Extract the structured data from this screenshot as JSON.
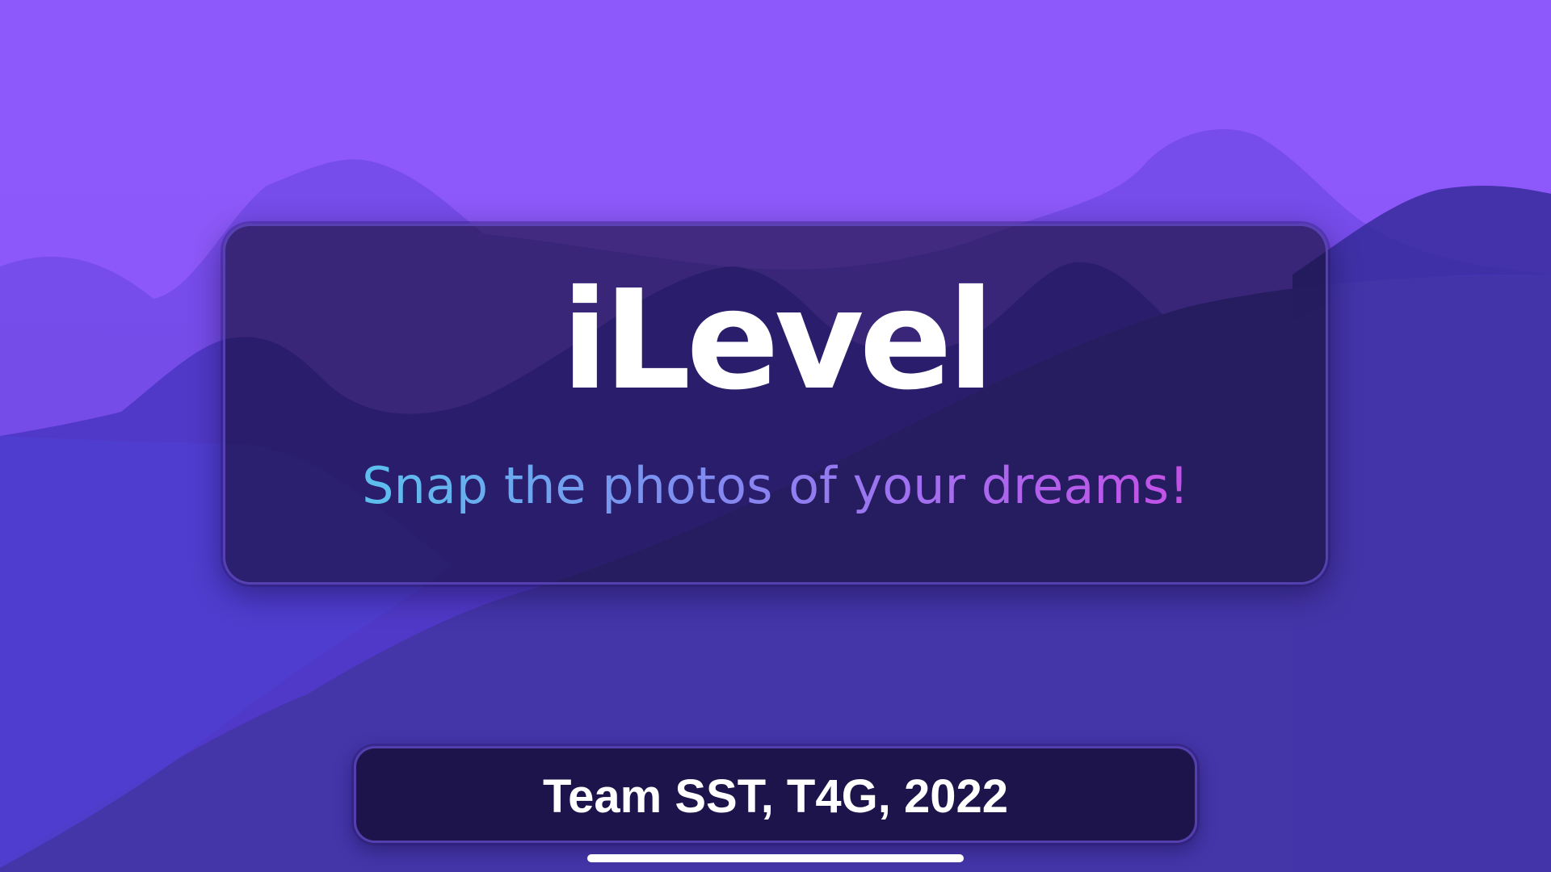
{
  "app": {
    "title": "iLevel",
    "tagline": "Snap the photos of your dreams!"
  },
  "footer": {
    "credit": "Team SST, T4G, 2022"
  },
  "colors": {
    "sky": "#8e59f8",
    "card_background": "#160f3a",
    "card_border": "#5f46be",
    "title_text": "#ffffff",
    "tagline_gradient_start": "#5cc0ee",
    "tagline_gradient_end": "#c450e6"
  }
}
